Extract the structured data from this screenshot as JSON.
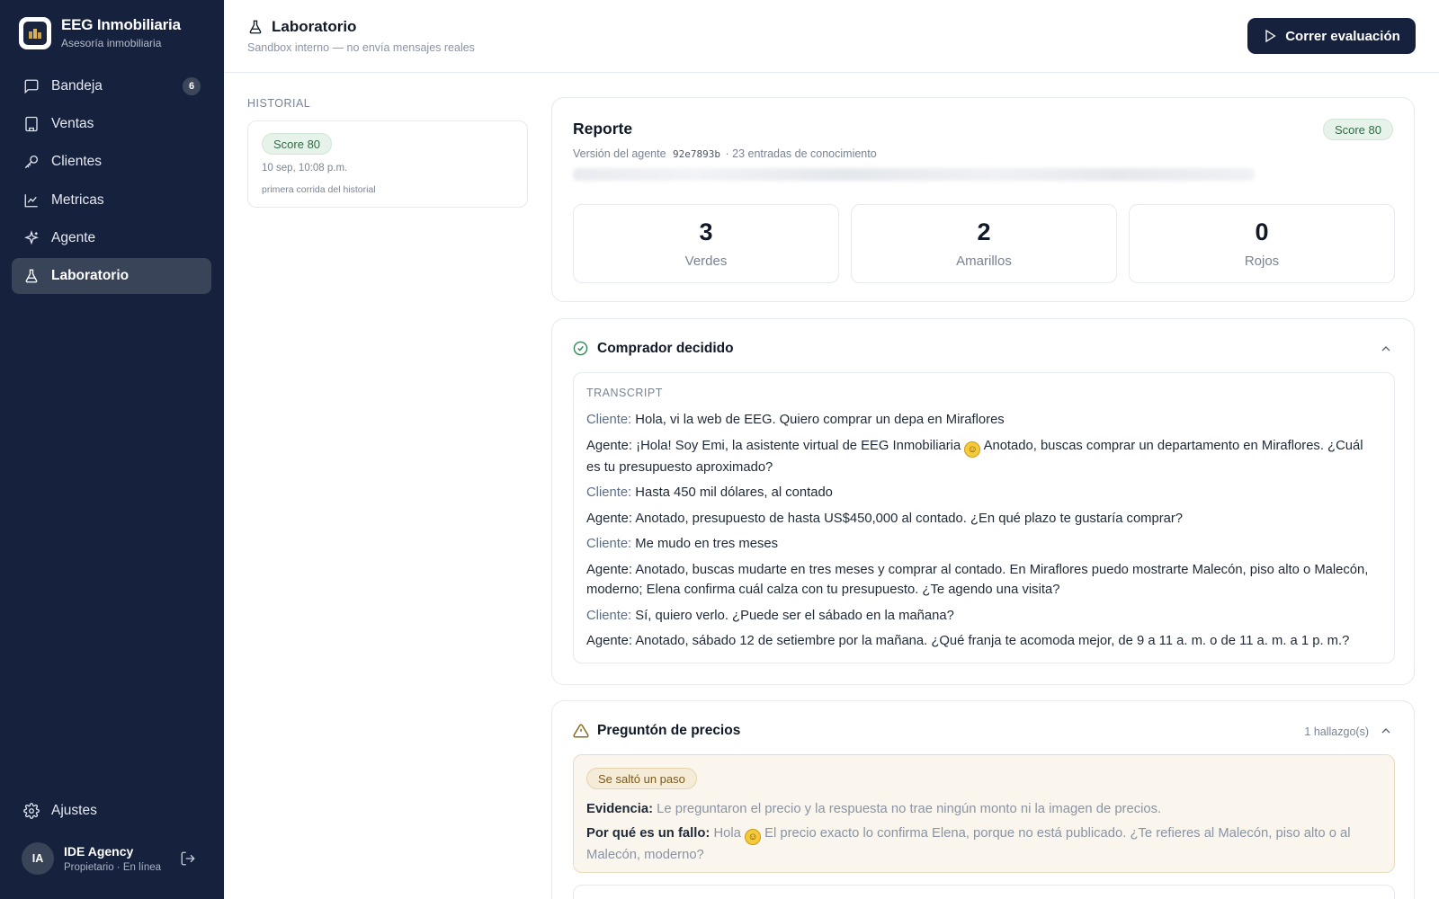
{
  "brand": {
    "name": "EEG Inmobiliaria",
    "subtitle": "Asesoría inmobiliaria"
  },
  "nav": {
    "items": [
      {
        "label": "Bandeja",
        "icon": "message-square-icon",
        "badge": "6"
      },
      {
        "label": "Ventas",
        "icon": "building-icon"
      },
      {
        "label": "Clientes",
        "icon": "key-icon"
      },
      {
        "label": "Metricas",
        "icon": "line-chart-icon"
      },
      {
        "label": "Agente",
        "icon": "sparkles-icon"
      },
      {
        "label": "Laboratorio",
        "icon": "flask-icon",
        "active": true
      }
    ],
    "settings_label": "Ajustes"
  },
  "user": {
    "initials": "IA",
    "name": "IDE Agency",
    "role": "Propietario · En línea"
  },
  "header": {
    "title": "Laboratorio",
    "subtitle": "Sandbox interno — no envía mensajes reales",
    "run_button": "Correr evaluación"
  },
  "history": {
    "label": "HISTORIAL",
    "entries": [
      {
        "score": "Score 80",
        "date": "10 sep, 10:08 p.m.",
        "note": "primera corrida del historial"
      }
    ]
  },
  "report": {
    "title": "Reporte",
    "score": "Score 80",
    "meta_prefix": "Versión del agente",
    "version_code": "92e7893b",
    "meta_suffix": "· 23 entradas de conocimiento",
    "stats": [
      {
        "value": "3",
        "label": "Verdes"
      },
      {
        "value": "2",
        "label": "Amarillos"
      },
      {
        "value": "0",
        "label": "Rojos"
      }
    ]
  },
  "scenario1": {
    "title": "Comprador decidido",
    "status": "pass",
    "transcript_label": "TRANSCRIPT",
    "lines": [
      {
        "speaker": "Cliente:",
        "text": "Hola, vi la web de EEG. Quiero comprar un depa en Miraflores"
      },
      {
        "speaker": "Agente:",
        "text": "¡Hola! Soy Emi, la asistente virtual de EEG Inmobiliaria",
        "emoji": true,
        "text_after": "Anotado, buscas comprar un departamento en Miraflores. ¿Cuál es tu presupuesto aproximado?"
      },
      {
        "speaker": "Cliente:",
        "text": "Hasta 450 mil dólares, al contado"
      },
      {
        "speaker": "Agente:",
        "text": "Anotado, presupuesto de hasta US$450,000 al contado. ¿En qué plazo te gustaría comprar?"
      },
      {
        "speaker": "Cliente:",
        "text": "Me mudo en tres meses"
      },
      {
        "speaker": "Agente:",
        "text": "Anotado, buscas mudarte en tres meses y comprar al contado. En Miraflores puedo mostrarte Malecón, piso alto o Malecón, moderno; Elena confirma cuál calza con tu presupuesto. ¿Te agendo una visita?"
      },
      {
        "speaker": "Cliente:",
        "text": "Sí, quiero verlo. ¿Puede ser el sábado en la mañana?"
      },
      {
        "speaker": "Agente:",
        "text": "Anotado, sábado 12 de setiembre por la mañana. ¿Qué franja te acomoda mejor, de 9 a 11 a. m. o de 11 a. m. a 1 p. m.?"
      }
    ]
  },
  "scenario2": {
    "title": "Preguntón de precios",
    "status": "warning",
    "findings": "1 hallazgo(s)",
    "tag": "Se saltó un paso",
    "evidence_label": "Evidencia:",
    "evidence": "Le preguntaron el precio y la respuesta no trae ningún monto ni la imagen de precios.",
    "why_label": "Por qué es un fallo:",
    "why_before": "Hola",
    "why_after": "El precio exacto lo confirma Elena, porque no está publicado. ¿Te refieres al Malecón, piso alto o al Malecón, moderno?"
  },
  "colors": {
    "sidebar": "#16213d",
    "accent_green": "#2f6b45",
    "warning": "#7a5a1d",
    "client_speaker": "#5b6e8a"
  }
}
